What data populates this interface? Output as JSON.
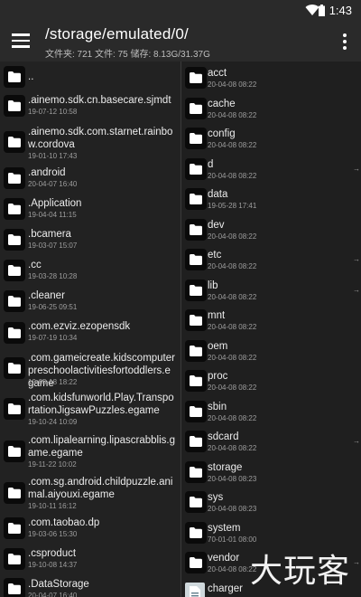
{
  "status": {
    "time": "1:43"
  },
  "appbar": {
    "path": "/storage/emulated/0/",
    "stats": "文件夹: 721  文件: 75  储存: 8.13G/31.37G"
  },
  "left_pane": [
    {
      "name": "..",
      "date": ""
    },
    {
      "name": ".ainemo.sdk.cn.basecare.sjmdt",
      "date": "19-07-12 10:58"
    },
    {
      "name": ".ainemo.sdk.com.starnet.rainbow.cordova",
      "date": "19-01-10 17:43"
    },
    {
      "name": ".android",
      "date": "20-04-07 16:40"
    },
    {
      "name": ".Application",
      "date": "19-04-04 11:15"
    },
    {
      "name": ".bcamera",
      "date": "19-03-07 15:07"
    },
    {
      "name": ".cc",
      "date": "19-03-28 10:28"
    },
    {
      "name": ".cleaner",
      "date": "19-06-25 09:51"
    },
    {
      "name": ".com.ezviz.ezopensdk",
      "date": "19-07-19 10:34"
    },
    {
      "name": ".com.gameicreate.kidscomputerpreschoolactivitiesfortoddlers.egame",
      "date": "19-05-18 18:22"
    },
    {
      "name": ".com.kidsfunworld.Play.TransportationJigsawPuzzles.egame",
      "date": "19-10-24 10:09"
    },
    {
      "name": ".com.lipalearning.lipascrabblis.game.egame",
      "date": "19-11-22 10:02"
    },
    {
      "name": ".com.sg.android.childpuzzle.animal.aiyouxi.egame",
      "date": "19-10-11 16:12"
    },
    {
      "name": ".com.taobao.dp",
      "date": "19-03-06 15:30"
    },
    {
      "name": ".csproduct",
      "date": "19-10-08 14:37"
    },
    {
      "name": ".DataStorage",
      "date": "20-04-07 16:40"
    }
  ],
  "right_pane": [
    {
      "name": "acct",
      "date": "20-04-08 08:22",
      "link": false
    },
    {
      "name": "cache",
      "date": "20-04-08 08:22",
      "link": false
    },
    {
      "name": "config",
      "date": "20-04-08 08:22",
      "link": false
    },
    {
      "name": "d",
      "date": "20-04-08 08:22",
      "link": true
    },
    {
      "name": "data",
      "date": "19-05-28 17:41",
      "link": false
    },
    {
      "name": "dev",
      "date": "20-04-08 08:22",
      "link": false
    },
    {
      "name": "etc",
      "date": "20-04-08 08:22",
      "link": true
    },
    {
      "name": "lib",
      "date": "20-04-08 08:22",
      "link": true
    },
    {
      "name": "mnt",
      "date": "20-04-08 08:22",
      "link": false
    },
    {
      "name": "oem",
      "date": "20-04-08 08:22",
      "link": false
    },
    {
      "name": "proc",
      "date": "20-04-08 08:22",
      "link": false
    },
    {
      "name": "sbin",
      "date": "20-04-08 08:22",
      "link": false
    },
    {
      "name": "sdcard",
      "date": "20-04-08 08:22",
      "link": true
    },
    {
      "name": "storage",
      "date": "20-04-08 08:23",
      "link": false
    },
    {
      "name": "sys",
      "date": "20-04-08 08:23",
      "link": false
    },
    {
      "name": "system",
      "date": "70-01-01 08:00",
      "link": false
    },
    {
      "name": "vendor",
      "date": "20-04-08 08:22",
      "link": true
    },
    {
      "name": "charger",
      "date": "",
      "link": false,
      "file": true
    }
  ],
  "watermark": "大玩客"
}
